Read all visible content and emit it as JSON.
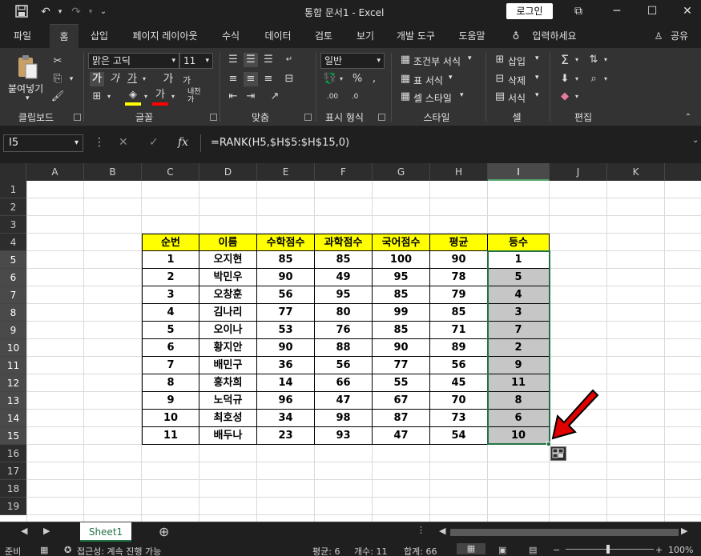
{
  "titlebar": {
    "title": "통합 문서1  -  Excel",
    "login": "로그인"
  },
  "tabs": [
    "파일",
    "홈",
    "삽입",
    "페이지 레이아웃",
    "수식",
    "데이터",
    "검토",
    "보기",
    "개발 도구",
    "도움말",
    "입력하세요",
    "공유"
  ],
  "ribbon": {
    "clipboard": {
      "paste": "붙여넣기",
      "label": "클립보드"
    },
    "font": {
      "name": "맑은 고딕",
      "size": "11",
      "bold": "가",
      "italic": "가",
      "underline": "가",
      "grow": "가",
      "shrink": "가",
      "label": "글꼴",
      "ruby": "내천",
      "ruby2": "가"
    },
    "align": {
      "label": "맞춤"
    },
    "number": {
      "format": "일반",
      "percent": "%",
      "label": "표시 형식"
    },
    "styles": {
      "conditional": "조건부 서식",
      "table": "표 서식",
      "cell": "셀 스타일",
      "label": "스타일"
    },
    "cells": {
      "insert": "삽입",
      "delete": "삭제",
      "format": "서식",
      "label": "셀"
    },
    "editing": {
      "label": "편집"
    }
  },
  "formula": {
    "namebox": "I5",
    "fx": "fx",
    "text": "=RANK(H5,$H$5:$H$15,0)"
  },
  "columns": [
    "A",
    "B",
    "C",
    "D",
    "E",
    "F",
    "G",
    "H",
    "I",
    "J",
    "K"
  ],
  "rows": [
    "1",
    "2",
    "3",
    "4",
    "5",
    "6",
    "7",
    "8",
    "9",
    "10",
    "11",
    "12",
    "13",
    "14",
    "15",
    "16",
    "17",
    "18",
    "19"
  ],
  "table": {
    "headers": [
      "순번",
      "이름",
      "수학점수",
      "과학점수",
      "국어점수",
      "평균",
      "등수"
    ],
    "data": [
      [
        "1",
        "오지현",
        "85",
        "85",
        "100",
        "90",
        "1"
      ],
      [
        "2",
        "박민우",
        "90",
        "49",
        "95",
        "78",
        "5"
      ],
      [
        "3",
        "오창훈",
        "56",
        "95",
        "85",
        "79",
        "4"
      ],
      [
        "4",
        "김나리",
        "77",
        "80",
        "99",
        "85",
        "3"
      ],
      [
        "5",
        "오이나",
        "53",
        "76",
        "85",
        "71",
        "7"
      ],
      [
        "6",
        "황지안",
        "90",
        "88",
        "90",
        "89",
        "2"
      ],
      [
        "7",
        "배민구",
        "36",
        "56",
        "77",
        "56",
        "9"
      ],
      [
        "8",
        "홍차희",
        "14",
        "66",
        "55",
        "45",
        "11"
      ],
      [
        "9",
        "노덕규",
        "96",
        "47",
        "67",
        "70",
        "8"
      ],
      [
        "10",
        "최호성",
        "34",
        "98",
        "87",
        "73",
        "6"
      ],
      [
        "11",
        "배두나",
        "23",
        "93",
        "47",
        "54",
        "10"
      ]
    ]
  },
  "sheet": {
    "name": "Sheet1"
  },
  "status": {
    "ready": "준비",
    "accessibility": "접근성: 계속 진행 가능",
    "average": "평균: 6",
    "count": "개수: 11",
    "sum": "합계: 66",
    "zoom": "100%"
  },
  "colors": {
    "accent": "#217346",
    "header_fill": "#ffff00",
    "rank_fill": "#c6c6c6",
    "arrow": "#e00000"
  }
}
